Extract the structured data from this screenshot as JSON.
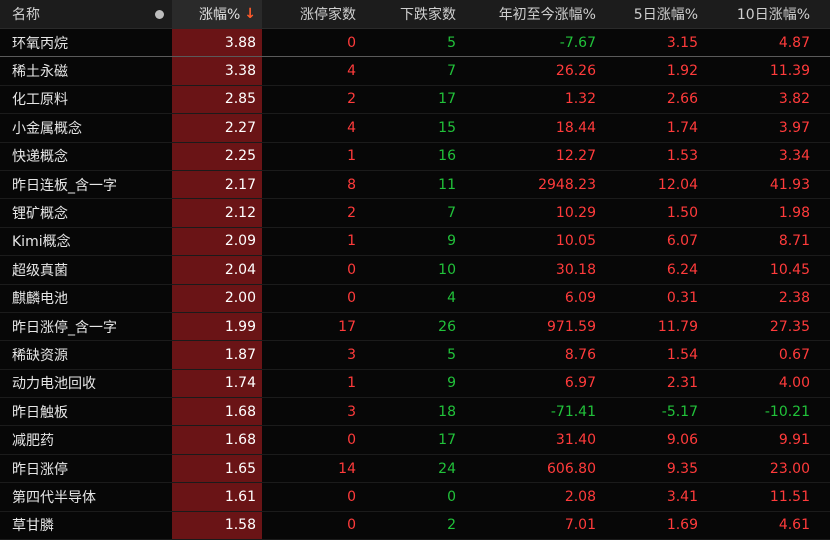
{
  "header": {
    "name": "名称",
    "change_pct": "涨幅%",
    "sort_arrow": "↓",
    "limit_up_count": "涨停家数",
    "down_count": "下跌家数",
    "ytd_pct": "年初至今涨幅%",
    "d5_pct": "5日涨幅%",
    "d10_pct": "10日涨幅%"
  },
  "colors": {
    "up": "#ff3b3b",
    "down": "#21c23a",
    "highlight": "#6a1416"
  },
  "rows": [
    {
      "name": "环氧丙烷",
      "chg": "3.88",
      "up": "0",
      "dn": "5",
      "ytd": "-7.67",
      "d5": "3.15",
      "d10": "4.87"
    },
    {
      "name": "稀土永磁",
      "chg": "3.38",
      "up": "4",
      "dn": "7",
      "ytd": "26.26",
      "d5": "1.92",
      "d10": "11.39"
    },
    {
      "name": "化工原料",
      "chg": "2.85",
      "up": "2",
      "dn": "17",
      "ytd": "1.32",
      "d5": "2.66",
      "d10": "3.82"
    },
    {
      "name": "小金属概念",
      "chg": "2.27",
      "up": "4",
      "dn": "15",
      "ytd": "18.44",
      "d5": "1.74",
      "d10": "3.97"
    },
    {
      "name": "快递概念",
      "chg": "2.25",
      "up": "1",
      "dn": "16",
      "ytd": "12.27",
      "d5": "1.53",
      "d10": "3.34"
    },
    {
      "name": "昨日连板_含一字",
      "chg": "2.17",
      "up": "8",
      "dn": "11",
      "ytd": "2948.23",
      "d5": "12.04",
      "d10": "41.93"
    },
    {
      "name": "锂矿概念",
      "chg": "2.12",
      "up": "2",
      "dn": "7",
      "ytd": "10.29",
      "d5": "1.50",
      "d10": "1.98"
    },
    {
      "name": "Kimi概念",
      "chg": "2.09",
      "up": "1",
      "dn": "9",
      "ytd": "10.05",
      "d5": "6.07",
      "d10": "8.71"
    },
    {
      "name": "超级真菌",
      "chg": "2.04",
      "up": "0",
      "dn": "10",
      "ytd": "30.18",
      "d5": "6.24",
      "d10": "10.45"
    },
    {
      "name": "麒麟电池",
      "chg": "2.00",
      "up": "0",
      "dn": "4",
      "ytd": "6.09",
      "d5": "0.31",
      "d10": "2.38"
    },
    {
      "name": "昨日涨停_含一字",
      "chg": "1.99",
      "up": "17",
      "dn": "26",
      "ytd": "971.59",
      "d5": "11.79",
      "d10": "27.35"
    },
    {
      "name": "稀缺资源",
      "chg": "1.87",
      "up": "3",
      "dn": "5",
      "ytd": "8.76",
      "d5": "1.54",
      "d10": "0.67"
    },
    {
      "name": "动力电池回收",
      "chg": "1.74",
      "up": "1",
      "dn": "9",
      "ytd": "6.97",
      "d5": "2.31",
      "d10": "4.00"
    },
    {
      "name": "昨日触板",
      "chg": "1.68",
      "up": "3",
      "dn": "18",
      "ytd": "-71.41",
      "d5": "-5.17",
      "d10": "-10.21"
    },
    {
      "name": "减肥药",
      "chg": "1.68",
      "up": "0",
      "dn": "17",
      "ytd": "31.40",
      "d5": "9.06",
      "d10": "9.91"
    },
    {
      "name": "昨日涨停",
      "chg": "1.65",
      "up": "14",
      "dn": "24",
      "ytd": "606.80",
      "d5": "9.35",
      "d10": "23.00"
    },
    {
      "name": "第四代半导体",
      "chg": "1.61",
      "up": "0",
      "dn": "0",
      "ytd": "2.08",
      "d5": "3.41",
      "d10": "11.51"
    },
    {
      "name": "草甘膦",
      "chg": "1.58",
      "up": "0",
      "dn": "2",
      "ytd": "7.01",
      "d5": "1.69",
      "d10": "4.61"
    }
  ]
}
